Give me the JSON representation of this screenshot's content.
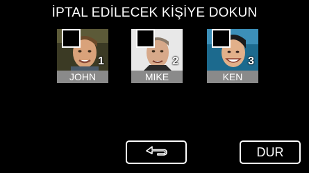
{
  "header": {
    "title": "İPTAL EDİLECEK KİŞİYE DOKUN"
  },
  "people": [
    {
      "name": "JOHN",
      "number": "1",
      "checked": false,
      "icon": "face-photo"
    },
    {
      "name": "MIKE",
      "number": "2",
      "checked": false,
      "icon": "face-photo"
    },
    {
      "name": "KEN",
      "number": "3",
      "checked": false,
      "icon": "face-photo"
    }
  ],
  "buttons": {
    "back_icon": "return-arrow-icon",
    "stop_label": "DUR"
  },
  "colors": {
    "background": "#000000",
    "name_plate": "#8a8a8a",
    "text": "#ffffff"
  }
}
